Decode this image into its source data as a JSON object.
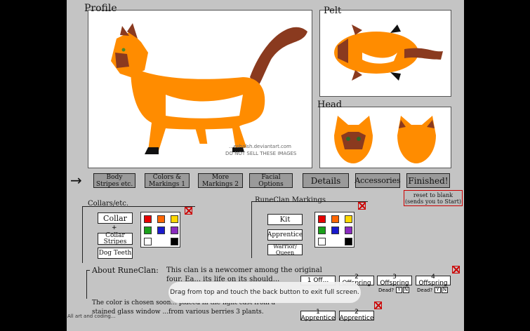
{
  "sections": {
    "profile": "Profile",
    "pelt": "Pelt",
    "head": "Head"
  },
  "watermark": {
    "line1": "...eshalsh.deviantart.com",
    "line2": "DO NOT SELL THESE IMAGES"
  },
  "arrow": "→",
  "tabs": [
    {
      "label": "Body Stripes etc."
    },
    {
      "label": "Colors & Markings 1"
    },
    {
      "label": "More Markings 2"
    },
    {
      "label": "Facial Options"
    },
    {
      "label": "Details"
    },
    {
      "label": "Accessories"
    },
    {
      "label": "Finished!"
    }
  ],
  "reset": "reset to blank (sends you to Start)",
  "collars": {
    "title": "Collars/etc.",
    "collar": "Collar",
    "plus": "+",
    "stripes": "Collar Stripes",
    "dog_teeth": "Dog Teeth"
  },
  "markings": {
    "title": "RuneClan Markings",
    "kit": "Kit",
    "apprentice": "Apprentice",
    "warrior": "Warrior/ Queen"
  },
  "colors": {
    "palette": [
      "#e60000",
      "#ff6600",
      "#ffd700",
      "#1aa01a",
      "#1a1acc",
      "#8a2bbf",
      "#ffffff",
      "#000000"
    ]
  },
  "about": {
    "heading": "About RuneClan:",
    "text": "This clan is a newcomer among the original four. Ea... its life on its should...",
    "text2": "The color is chosen soon... placed in the light cast from a stained glass window ...from various berries 3 plants."
  },
  "offspring": {
    "items": [
      "1 Off...",
      "2 Offspring",
      "3 Offspring",
      "4 Offspring"
    ],
    "dead": "Dead?",
    "y": "Y",
    "n": "N"
  },
  "apprentices": [
    "1 Apprentice",
    "2 Apprentice"
  ],
  "credit": "All art and coding...",
  "toast": "Drag from top and touch the back button to exit full screen."
}
